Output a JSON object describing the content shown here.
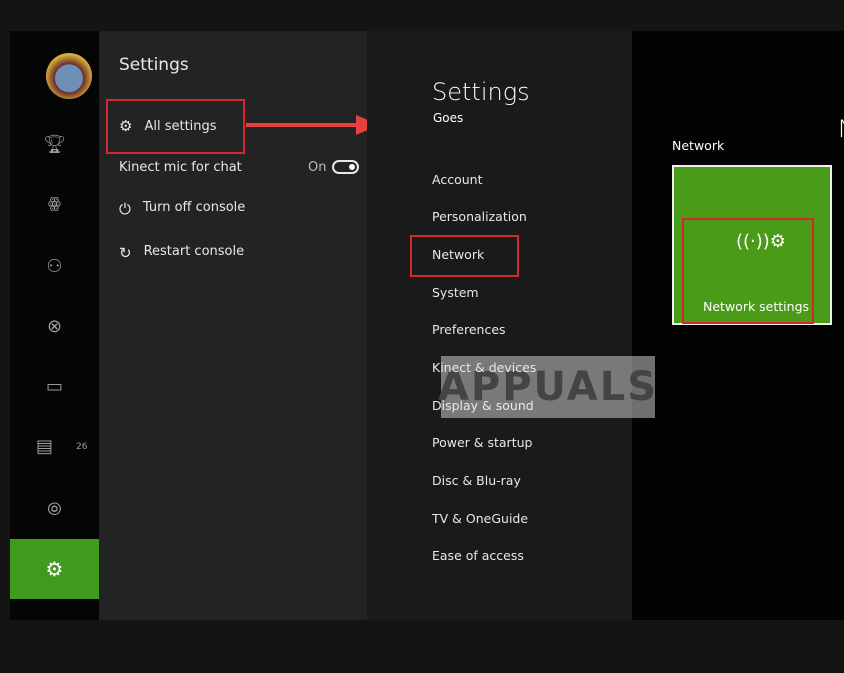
{
  "nav": {
    "badge_count": "26",
    "icons": [
      "avatar",
      "trophy-icon",
      "friends-icon",
      "people-icon",
      "xbox-icon",
      "devices-icon",
      "messages-icon",
      "broadcast-icon",
      "settings-icon"
    ]
  },
  "guide": {
    "title": "Settings",
    "items": [
      {
        "label": "All settings",
        "icon": "gear-icon"
      },
      {
        "label": "Kinect mic for chat",
        "value": "On"
      },
      {
        "label": "Turn off console",
        "icon": "power-icon"
      },
      {
        "label": "Restart console",
        "icon": "restart-icon"
      }
    ]
  },
  "settings": {
    "title": "Settings",
    "subtitle": "Goes",
    "menu": [
      "Account",
      "Personalization",
      "Network",
      "System",
      "Preferences",
      "Kinect & devices",
      "Display & sound",
      "Power & startup",
      "Disc & Blu-ray",
      "TV & OneGuide",
      "Ease of access"
    ]
  },
  "network": {
    "heading": "Network",
    "tile_label": "Network settings",
    "partial_letter": "N"
  },
  "watermark": "APPUALS",
  "colors": {
    "accent": "#3f9a1e",
    "highlight": "#d9262b"
  }
}
